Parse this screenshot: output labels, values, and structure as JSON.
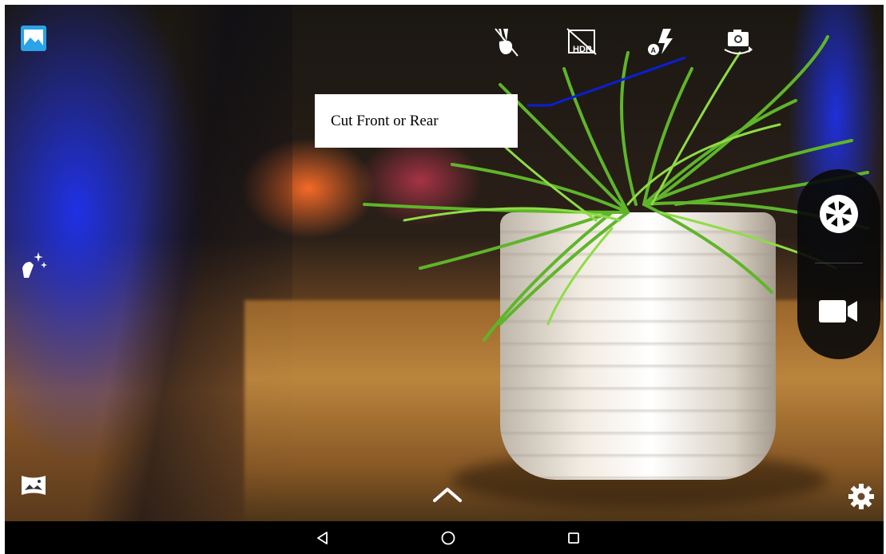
{
  "top_toolbar": {
    "items": [
      {
        "name": "gesture-shot-icon"
      },
      {
        "name": "hdr-off-icon",
        "label": "HDR"
      },
      {
        "name": "flash-auto-icon",
        "label": "A"
      },
      {
        "name": "switch-camera-icon"
      }
    ]
  },
  "annotation": {
    "text": "Cut Front or Rear",
    "line_color": "#0a1fd6"
  },
  "left_toolbar": {
    "items": [
      {
        "name": "gallery-icon"
      },
      {
        "name": "beauty-wand-icon"
      },
      {
        "name": "panorama-icon"
      }
    ]
  },
  "mode_switcher": {
    "photo": {
      "name": "shutter-aperture-icon"
    },
    "video": {
      "name": "video-camera-icon"
    }
  },
  "bottom": {
    "expand": {
      "name": "chevron-up-icon"
    },
    "settings": {
      "name": "gear-icon"
    }
  },
  "nav_bar": {
    "back": {
      "name": "back-icon"
    },
    "home": {
      "name": "home-icon"
    },
    "recents": {
      "name": "recents-icon"
    }
  },
  "colors": {
    "accent_blue": "#2aa3e8",
    "nav_bg": "#000000",
    "pill_bg": "#0a0a0a"
  }
}
